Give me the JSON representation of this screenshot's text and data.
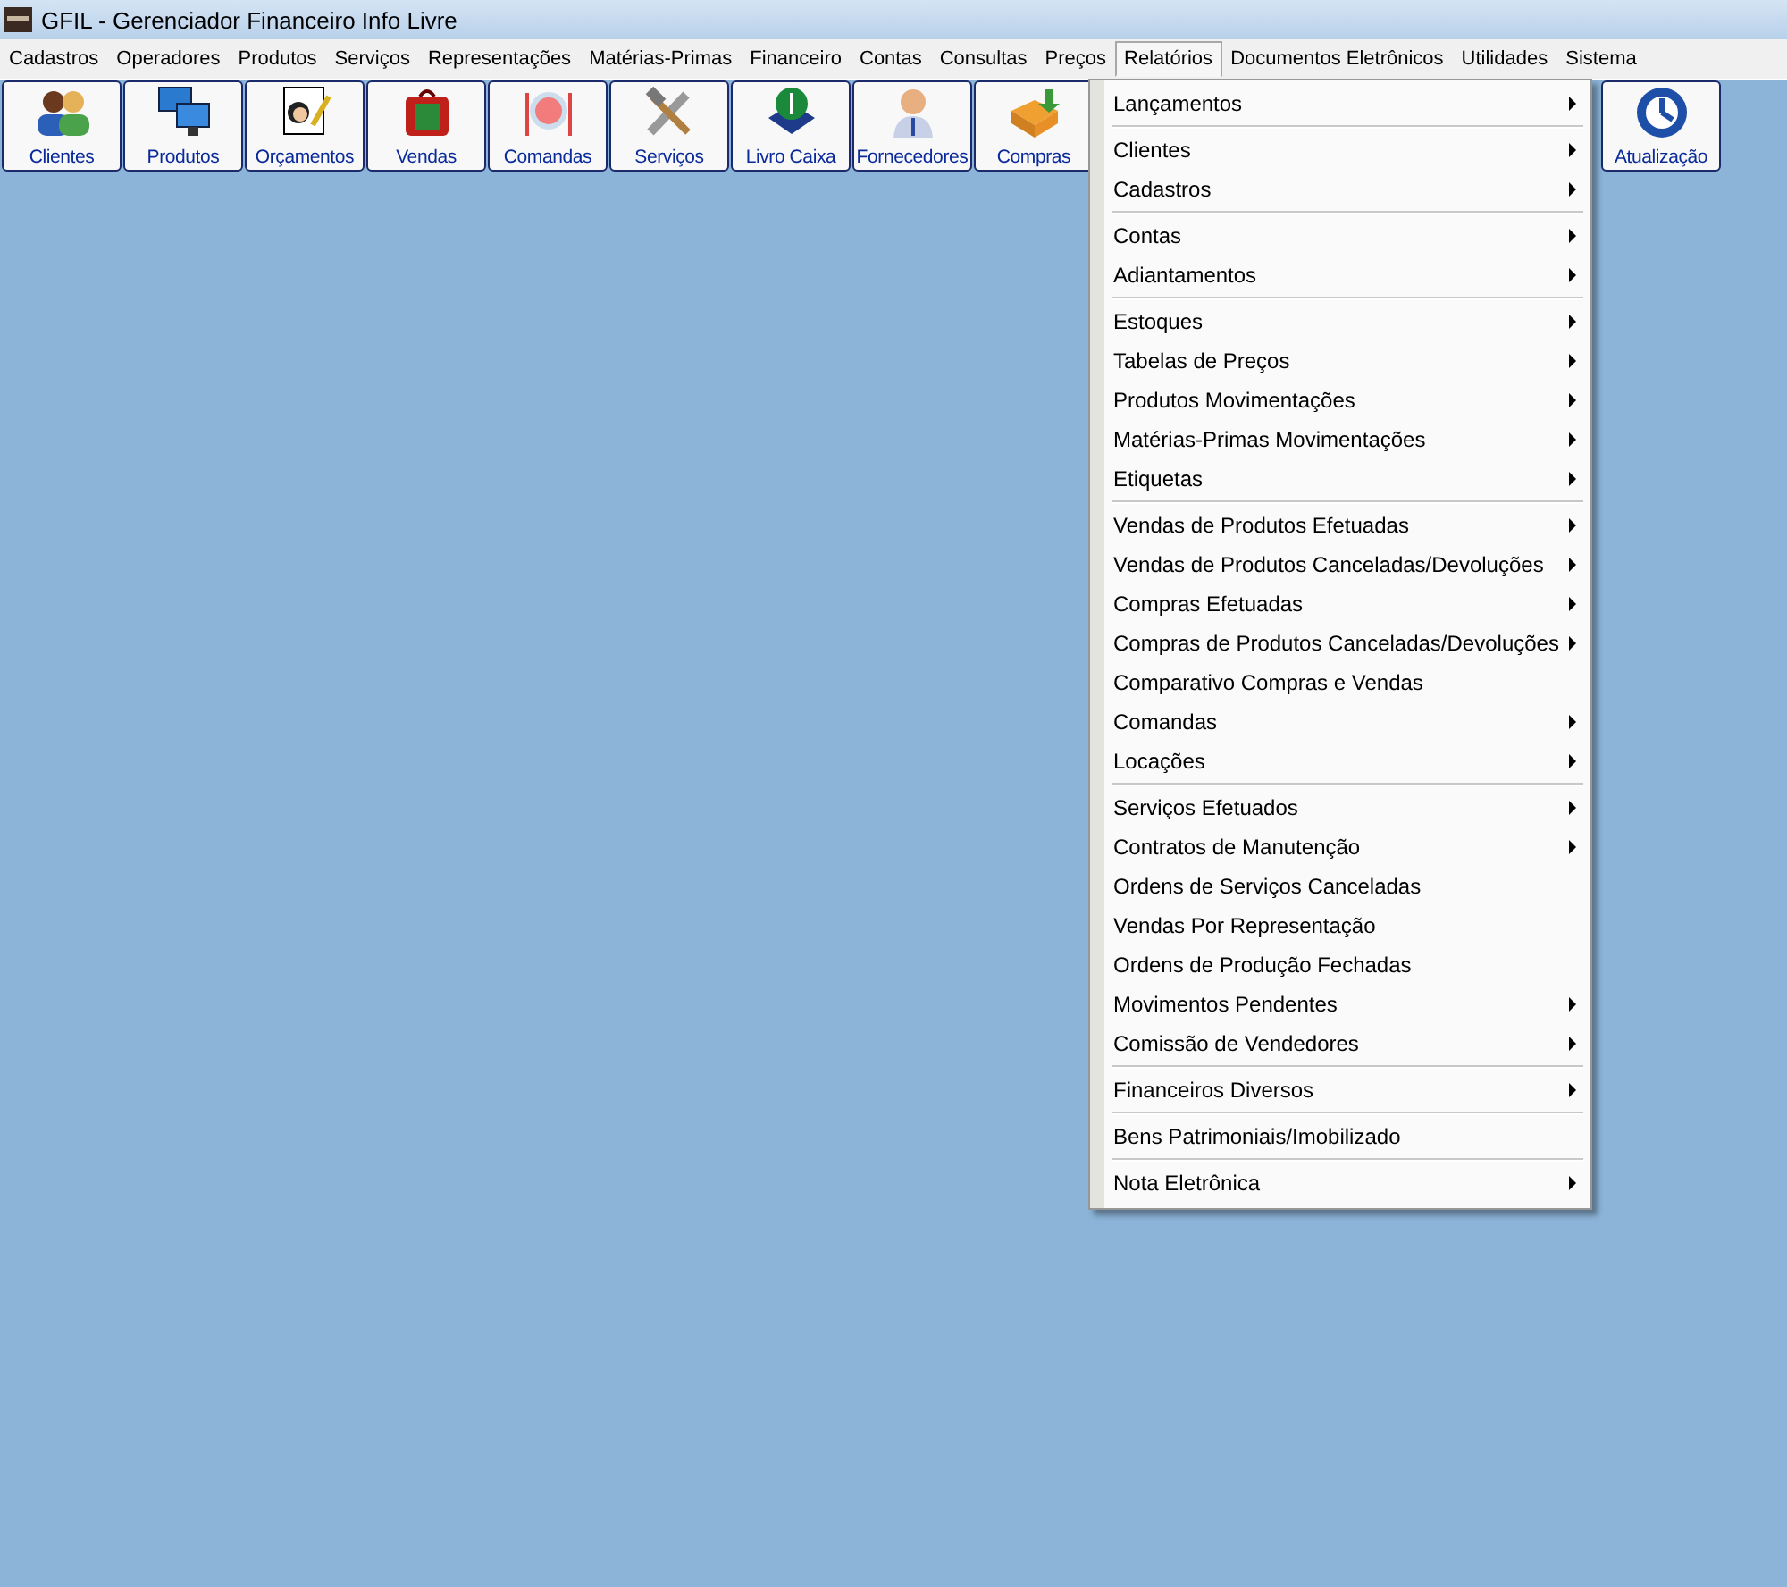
{
  "window": {
    "title": "GFIL - Gerenciador Financeiro Info Livre"
  },
  "menubar": [
    {
      "label": "Cadastros",
      "selected": false
    },
    {
      "label": "Operadores",
      "selected": false
    },
    {
      "label": "Produtos",
      "selected": false
    },
    {
      "label": "Serviços",
      "selected": false
    },
    {
      "label": "Representações",
      "selected": false
    },
    {
      "label": "Matérias-Primas",
      "selected": false
    },
    {
      "label": "Financeiro",
      "selected": false
    },
    {
      "label": "Contas",
      "selected": false
    },
    {
      "label": "Consultas",
      "selected": false
    },
    {
      "label": "Preços",
      "selected": false
    },
    {
      "label": "Relatórios",
      "selected": true
    },
    {
      "label": "Documentos Eletrônicos",
      "selected": false
    },
    {
      "label": "Utilidades",
      "selected": false
    },
    {
      "label": "Sistema",
      "selected": false
    }
  ],
  "toolbar": [
    {
      "label": "Clientes"
    },
    {
      "label": "Produtos"
    },
    {
      "label": "Orçamentos"
    },
    {
      "label": "Vendas"
    },
    {
      "label": "Comandas"
    },
    {
      "label": "Serviços"
    },
    {
      "label": "Livro Caixa"
    },
    {
      "label": "Fornecedores"
    },
    {
      "label": "Compras"
    },
    {
      "label": "Atualização"
    }
  ],
  "dropdown_menu": {
    "groups": [
      [
        {
          "label": "Lançamentos",
          "submenu": true
        }
      ],
      [
        {
          "label": "Clientes",
          "submenu": true
        },
        {
          "label": "Cadastros",
          "submenu": true
        }
      ],
      [
        {
          "label": "Contas",
          "submenu": true
        },
        {
          "label": "Adiantamentos",
          "submenu": true
        }
      ],
      [
        {
          "label": "Estoques",
          "submenu": true
        },
        {
          "label": "Tabelas de Preços",
          "submenu": true
        },
        {
          "label": "Produtos Movimentações",
          "submenu": true
        },
        {
          "label": "Matérias-Primas Movimentações",
          "submenu": true
        },
        {
          "label": "Etiquetas",
          "submenu": true
        }
      ],
      [
        {
          "label": "Vendas de Produtos Efetuadas",
          "submenu": true
        },
        {
          "label": "Vendas de Produtos Canceladas/Devoluções",
          "submenu": true
        },
        {
          "label": "Compras Efetuadas",
          "submenu": true
        },
        {
          "label": "Compras de Produtos Canceladas/Devoluções",
          "submenu": true
        },
        {
          "label": "Comparativo Compras e Vendas",
          "submenu": false
        },
        {
          "label": "Comandas",
          "submenu": true
        },
        {
          "label": "Locações",
          "submenu": true
        }
      ],
      [
        {
          "label": "Serviços Efetuados",
          "submenu": true
        },
        {
          "label": "Contratos de Manutenção",
          "submenu": true
        },
        {
          "label": "Ordens de Serviços Canceladas",
          "submenu": false
        },
        {
          "label": "Vendas Por Representação",
          "submenu": false
        },
        {
          "label": "Ordens de Produção Fechadas",
          "submenu": false
        },
        {
          "label": "Movimentos Pendentes",
          "submenu": true
        },
        {
          "label": "Comissão de Vendedores",
          "submenu": true
        }
      ],
      [
        {
          "label": "Financeiros Diversos",
          "submenu": true
        }
      ],
      [
        {
          "label": "Bens Patrimoniais/Imobilizado",
          "submenu": false
        }
      ],
      [
        {
          "label": "Nota Eletrônica",
          "submenu": true
        }
      ]
    ]
  }
}
